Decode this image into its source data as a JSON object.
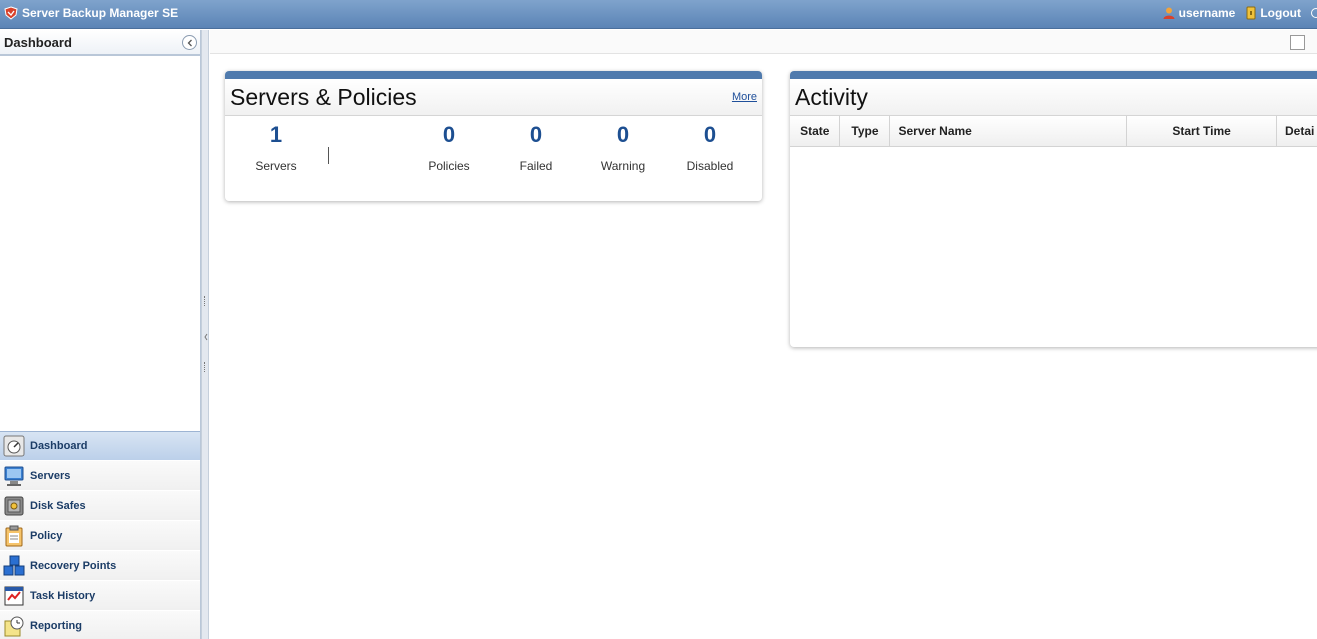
{
  "header": {
    "app_title": "Server Backup Manager SE",
    "username": "username",
    "logout_label": "Logout"
  },
  "left_panel": {
    "title": "Dashboard",
    "nav_items": [
      {
        "label": "Dashboard",
        "icon": "dashboard-icon",
        "active": true
      },
      {
        "label": "Servers",
        "icon": "server-icon",
        "active": false
      },
      {
        "label": "Disk Safes",
        "icon": "disk-safe-icon",
        "active": false
      },
      {
        "label": "Policy",
        "icon": "policy-icon",
        "active": false
      },
      {
        "label": "Recovery Points",
        "icon": "recovery-points-icon",
        "active": false
      },
      {
        "label": "Task History",
        "icon": "task-history-icon",
        "active": false
      },
      {
        "label": "Reporting",
        "icon": "reporting-icon",
        "active": false
      }
    ]
  },
  "servers_policies": {
    "title": "Servers & Policies",
    "more_label": "More",
    "stats": [
      {
        "value": "1",
        "label": "Servers"
      },
      {
        "value": "0",
        "label": "Policies"
      },
      {
        "value": "0",
        "label": "Failed"
      },
      {
        "value": "0",
        "label": "Warning"
      },
      {
        "value": "0",
        "label": "Disabled"
      }
    ]
  },
  "activity": {
    "title": "Activity",
    "columns": [
      "State",
      "Type",
      "Server Name",
      "Start Time",
      "Detai"
    ]
  },
  "colors": {
    "header_blue": "#5b84b6",
    "accent": "#4f7aad",
    "stat_number": "#1d4f91",
    "nav_text": "#1b3c66"
  }
}
